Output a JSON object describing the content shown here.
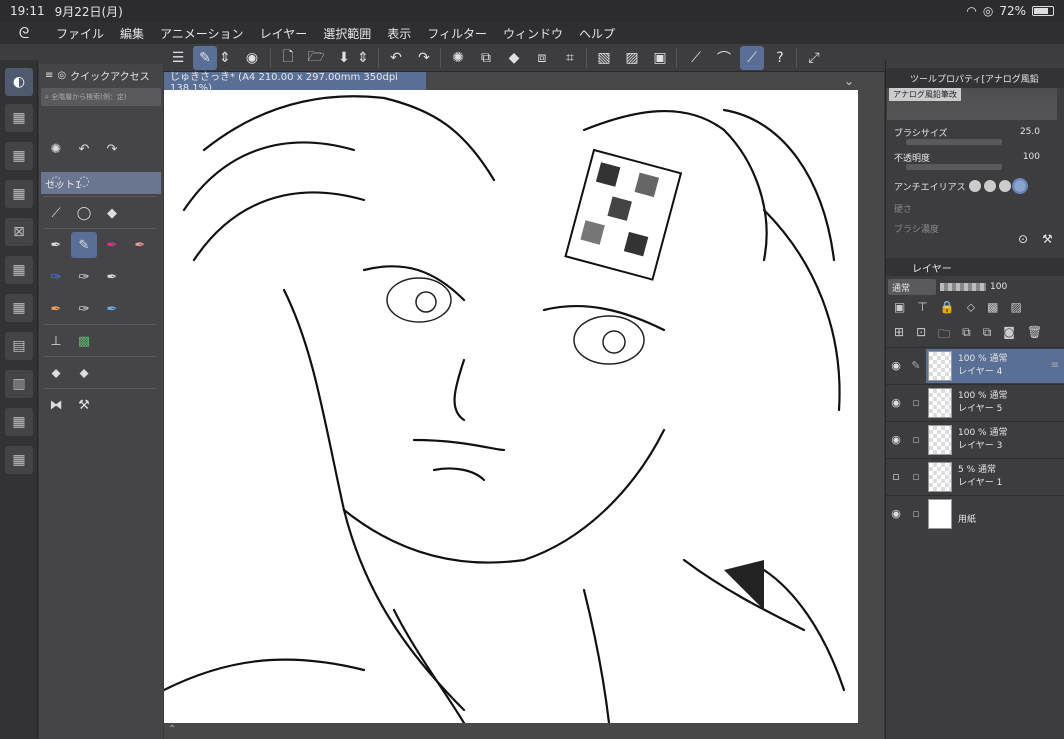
{
  "status": {
    "time": "19:11",
    "date": "9月22日(月)",
    "battery": "72%"
  },
  "menu": [
    "ファイル",
    "編集",
    "アニメーション",
    "レイヤー",
    "選択範囲",
    "表示",
    "フィルター",
    "ウィンドウ",
    "ヘルプ"
  ],
  "quick_access": {
    "title": "クイックアクセス",
    "search_placeholder": "全階層から検索(例：定)",
    "set_label": "セット1"
  },
  "document": {
    "tab_title": "じゅきさっき* (A4 210.00 x 297.00mm 350dpi 138.1%)"
  },
  "tool_property": {
    "title": "ツールプロパティ[アナログ風鉛",
    "preview_name": "アナログ風鉛筆改",
    "brush_size_label": "ブラシサイズ",
    "brush_size_value": "25.0",
    "opacity_label": "不透明度",
    "opacity_value": "100",
    "antialias_label": "アンチエイリアス",
    "hardness_label": "硬さ",
    "density_label": "ブラシ濃度"
  },
  "layers_panel": {
    "title": "レイヤー",
    "blend_mode": "通常",
    "opacity": "100",
    "layers": [
      {
        "info": "100 % 通常",
        "name": "レイヤー 4",
        "selected": true,
        "visible": true,
        "editing": true
      },
      {
        "info": "100 % 通常",
        "name": "レイヤー 5",
        "selected": false,
        "visible": true,
        "editing": false
      },
      {
        "info": "100 % 通常",
        "name": "レイヤー 3",
        "selected": false,
        "visible": true,
        "editing": false
      },
      {
        "info": "5 % 通常",
        "name": "レイヤー 1",
        "selected": false,
        "visible": false,
        "editing": false
      },
      {
        "info": "",
        "name": "用紙",
        "selected": false,
        "visible": true,
        "editing": false
      }
    ]
  },
  "colors": {
    "accent": "#5a6f96"
  }
}
